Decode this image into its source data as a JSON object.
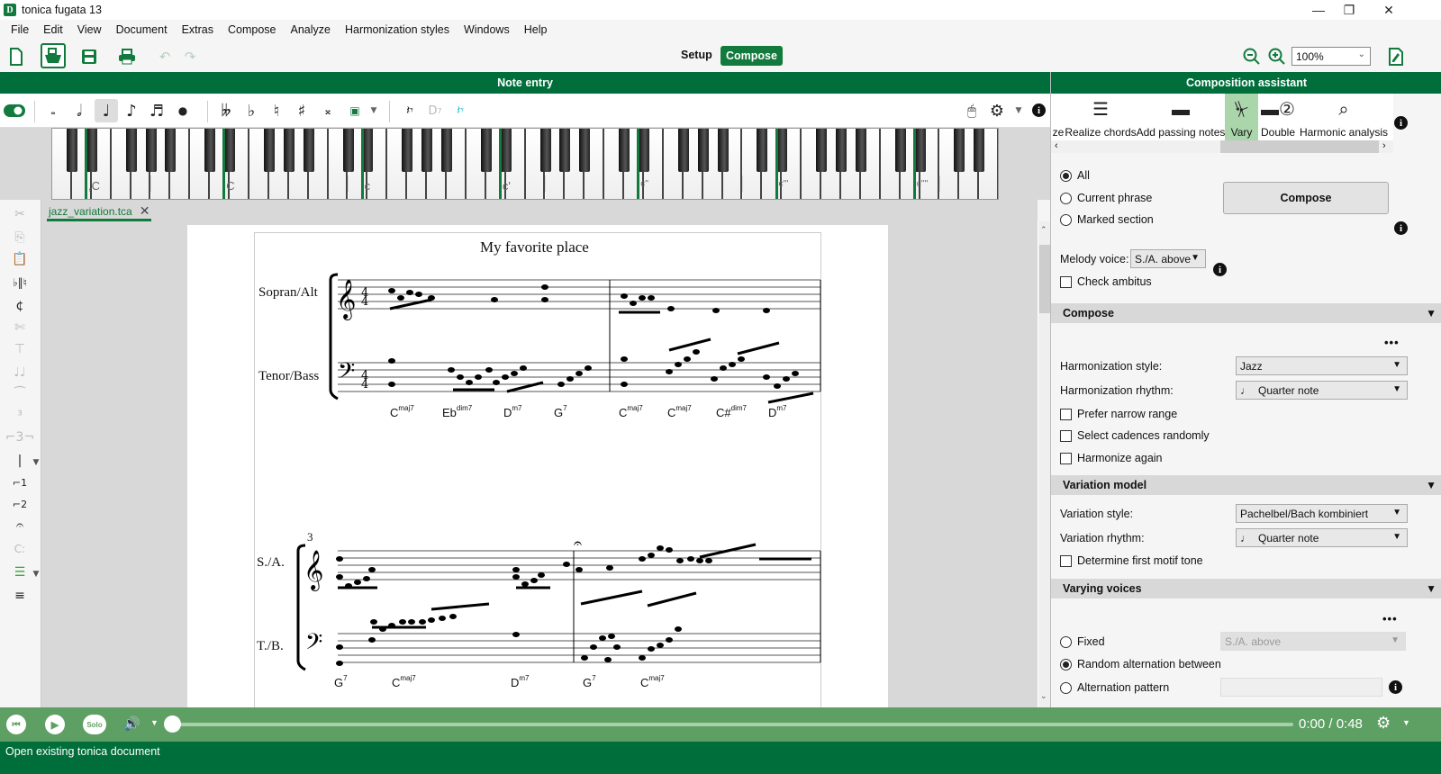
{
  "window": {
    "title": "tonica fugata 13",
    "logo": "D",
    "minimize": "—",
    "restore": "❐",
    "close": "✕"
  },
  "menu": [
    "File",
    "Edit",
    "View",
    "Document",
    "Extras",
    "Compose",
    "Analyze",
    "Harmonization styles",
    "Windows",
    "Help"
  ],
  "toolbar": {
    "icons": [
      "new-document-icon",
      "open-document-icon",
      "save-icon",
      "print-icon",
      "undo-icon",
      "redo-icon"
    ],
    "mode_setup": "Setup",
    "mode_compose": "Compose",
    "zoom_value": "100%"
  },
  "note_entry": {
    "header": "Note entry",
    "durations": [
      "whole",
      "half",
      "quarter",
      "eighth",
      "sixteenth",
      "dot"
    ],
    "selected_duration": "quarter",
    "accidentals": [
      "double-flat",
      "flat",
      "natural",
      "sharp",
      "double-sharp"
    ]
  },
  "keyboard": {
    "octave_labels": [
      ",C",
      "C",
      "c",
      "c'",
      "c''",
      "c'''",
      "c''''"
    ]
  },
  "document": {
    "tab_name": "jazz_variation.tca",
    "score_title": "My favorite place",
    "system1": {
      "upper_label": "Sopran/Alt",
      "lower_label": "Tenor/Bass",
      "time_signature": "4/4",
      "chords": [
        {
          "root": "C",
          "ext": "maj7"
        },
        {
          "root": "Eb",
          "ext": "dim7"
        },
        {
          "root": "D",
          "ext": "m7"
        },
        {
          "root": "G",
          "ext": "7"
        },
        {
          "root": "C",
          "ext": "maj7"
        },
        {
          "root": "C",
          "ext": "maj7"
        },
        {
          "root": "C#",
          "ext": "dim7"
        },
        {
          "root": "D",
          "ext": "m7"
        }
      ]
    },
    "system2": {
      "measure_number": "3",
      "upper_label": "S./A.",
      "lower_label": "T./B.",
      "chords": [
        {
          "root": "G",
          "ext": "7"
        },
        {
          "root": "C",
          "ext": "maj7"
        },
        {
          "root": "D",
          "ext": "m7"
        },
        {
          "root": "G",
          "ext": "7"
        },
        {
          "root": "C",
          "ext": "maj7"
        }
      ]
    }
  },
  "assistant": {
    "header": "Composition assistant",
    "ribbon": [
      {
        "label": "ze",
        "icon": ""
      },
      {
        "label": "Realize chords",
        "icon": "☰"
      },
      {
        "label": "Add passing notes",
        "icon": "⏜"
      },
      {
        "label": "Vary",
        "icon": "⌓",
        "active": true
      },
      {
        "label": "Double",
        "icon": "②"
      },
      {
        "label": "Harmonic analysis",
        "icon": "⌕"
      }
    ],
    "scope": {
      "options": [
        "All",
        "Current phrase",
        "Marked section"
      ],
      "selected": "All"
    },
    "compose_button": "Compose",
    "melody_voice_label": "Melody voice:",
    "melody_voice_value": "S./A. above",
    "check_ambitus": "Check ambitus",
    "compose_section": {
      "title": "Compose",
      "harmonization_style_label": "Harmonization style:",
      "harmonization_style_value": "Jazz",
      "harmonization_rhythm_label": "Harmonization rhythm:",
      "harmonization_rhythm_value": "Quarter note",
      "checks": [
        "Prefer narrow range",
        "Select cadences randomly",
        "Harmonize again"
      ]
    },
    "variation_section": {
      "title": "Variation model",
      "style_label": "Variation style:",
      "style_value": "Pachelbel/Bach kombiniert",
      "rhythm_label": "Variation rhythm:",
      "rhythm_value": "Quarter note",
      "first_motif": "Determine first motif tone"
    },
    "varying_section": {
      "title": "Varying voices",
      "fixed": "Fixed",
      "fixed_value": "S./A. above",
      "random": "Random alternation between",
      "pattern": "Alternation pattern",
      "selected": "Random alternation between"
    },
    "more": "•••"
  },
  "player": {
    "solo": "Solo",
    "time": "0:00 / 0:48",
    "progress": 0
  },
  "status": "Open existing tonica document"
}
